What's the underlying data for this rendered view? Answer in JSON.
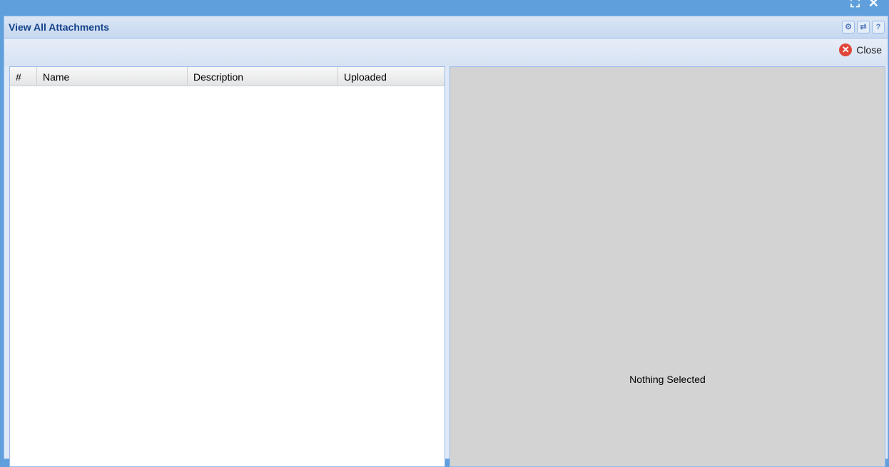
{
  "window": {
    "title": "View All Attachments",
    "tools": [
      "gear-icon",
      "refresh-icon",
      "help-icon"
    ]
  },
  "toolbar": {
    "close_label": "Close"
  },
  "grid": {
    "columns": [
      "#",
      "Name",
      "Description",
      "Uploaded"
    ],
    "rows": []
  },
  "preview": {
    "empty_text": "Nothing Selected"
  }
}
